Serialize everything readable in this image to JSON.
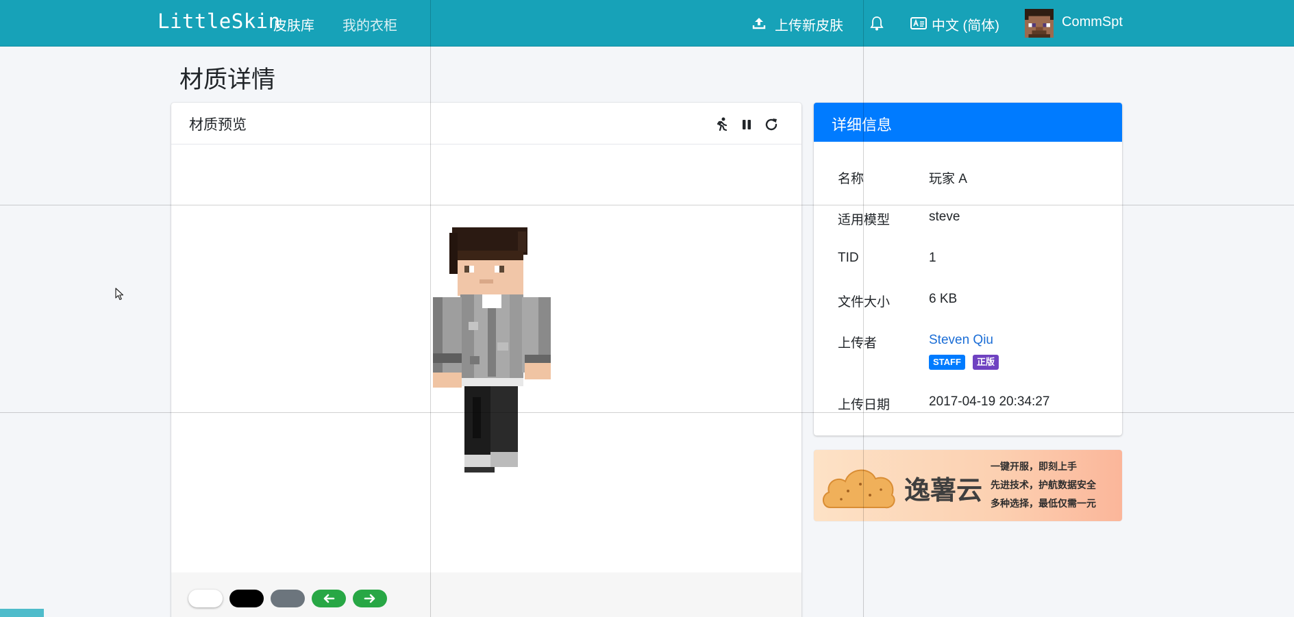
{
  "navbar": {
    "brand": "LittleSkin",
    "links": [
      "皮肤库",
      "我的衣柜"
    ],
    "upload": "上传新皮肤",
    "language": "中文 (简体)",
    "username": "CommSpt",
    "icons": [
      "upload-icon",
      "bell-icon",
      "language-icon",
      "avatar"
    ]
  },
  "page": {
    "title": "材质详情"
  },
  "preview": {
    "title": "材质预览",
    "tools": [
      "running-icon",
      "pause-icon",
      "reset-icon"
    ],
    "backgrounds": [
      {
        "name": "white",
        "color": "#ffffff"
      },
      {
        "name": "black",
        "color": "#000000"
      },
      {
        "name": "gray",
        "color": "#6c757d"
      }
    ],
    "nav_buttons": [
      "arrow-left-icon",
      "arrow-right-icon"
    ],
    "nav_color": "#28a745"
  },
  "details": {
    "title": "详细信息",
    "rows": [
      {
        "label": "名称",
        "value": "玩家 A"
      },
      {
        "label": "适用模型",
        "value": "steve"
      },
      {
        "label": "TID",
        "value": "1"
      },
      {
        "label": "文件大小",
        "value": "6 KB"
      },
      {
        "label": "上传者",
        "value": "Steven Qiu"
      },
      {
        "label": "上传日期",
        "value": "2017-04-19 20:34:27"
      }
    ],
    "badges": [
      {
        "text": "STAFF",
        "color": "#007bff"
      },
      {
        "text": "正版",
        "color": "#6f42c1"
      }
    ]
  },
  "ad": {
    "brand": "逸薯云",
    "lines": [
      "一键开服，即刻上手",
      "先进技术，护航数据安全",
      "多种选择，最低仅需一元"
    ]
  },
  "colors": {
    "navbar": "#17a2b8",
    "primary": "#007bff",
    "link": "#1a6dd6"
  }
}
